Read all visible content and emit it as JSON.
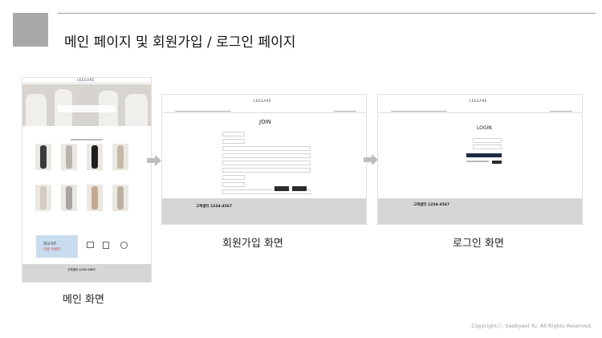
{
  "slide": {
    "title": "메인 페이지 및 회원가입 / 로그인 페이지",
    "copyright": "Copyrightⓒ. Saebyeol Yu. All Rights Reserved."
  },
  "captions": {
    "main": "메인 화면",
    "join": "회원가입 화면",
    "login": "로그인 화면"
  },
  "main_page": {
    "logo": "LEEGARE",
    "promo_line1": "레오하트",
    "promo_line2": "리뷰 이벤트",
    "footer_phone": "고객센터 1234-4567"
  },
  "join_page": {
    "logo": "LEEGARE",
    "title": "JOIN",
    "footer_phone": "고객센터 1234-4567"
  },
  "login_page": {
    "logo": "LEEGARE",
    "title": "LOGIN",
    "footer_phone": "고객센터 1234-4567"
  },
  "colors": {
    "deco_square": "#a9a9a9",
    "footer_gray": "#d6d6d6",
    "login_button": "#1e2a44",
    "arrow": "#bdbdbd"
  }
}
